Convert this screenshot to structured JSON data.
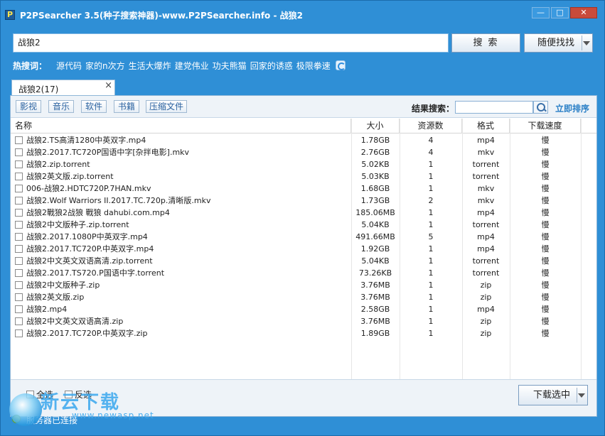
{
  "window": {
    "title": "P2PSearcher 3.5(种子搜索神器)-www.P2PSearcher.info - 战狼2",
    "logo_letter": "P",
    "minimize": "—",
    "maximize": "□",
    "close": "✕"
  },
  "search": {
    "query": "战狼2",
    "search_button": "搜索",
    "random_button": "随便找找"
  },
  "hot": {
    "label": "热搜词：",
    "items": [
      "源代码",
      "家的n次方",
      "生活大爆炸",
      "建党伟业",
      "功夫熊猫",
      "回家的诱惑",
      "极限拳速"
    ]
  },
  "tab": {
    "label": "战狼2(17)",
    "close": "×"
  },
  "toolbar": {
    "filters": [
      "影视",
      "音乐",
      "软件",
      "书籍",
      "压缩文件"
    ],
    "result_search_label": "结果搜索：",
    "sort_link": "立即排序"
  },
  "table": {
    "headers": [
      "名称",
      "大小",
      "资源数",
      "格式",
      "下载速度"
    ],
    "rows": [
      {
        "name": "战狼2.TS高清1280中英双字.mp4",
        "size": "1.78GB",
        "sources": "4",
        "format": "mp4",
        "speed": "慢"
      },
      {
        "name": "战狼2.2017.TC720P国语中字[杂拌电影].mkv",
        "size": "2.76GB",
        "sources": "4",
        "format": "mkv",
        "speed": "慢"
      },
      {
        "name": "战狼2.zip.torrent",
        "size": "5.02KB",
        "sources": "1",
        "format": "torrent",
        "speed": "慢"
      },
      {
        "name": "战狼2英文版.zip.torrent",
        "size": "5.03KB",
        "sources": "1",
        "format": "torrent",
        "speed": "慢"
      },
      {
        "name": "006-战狼2.HDTC720P.7HAN.mkv",
        "size": "1.68GB",
        "sources": "1",
        "format": "mkv",
        "speed": "慢"
      },
      {
        "name": "战狼2.Wolf Warriors II.2017.TC.720p.清晰版.mkv",
        "size": "1.73GB",
        "sources": "2",
        "format": "mkv",
        "speed": "慢"
      },
      {
        "name": "战狼2戰狼2战狼 戰狼 dahubi.com.mp4",
        "size": "185.06MB",
        "sources": "1",
        "format": "mp4",
        "speed": "慢"
      },
      {
        "name": "战狼2中文版种子.zip.torrent",
        "size": "5.04KB",
        "sources": "1",
        "format": "torrent",
        "speed": "慢"
      },
      {
        "name": "战狼2.2017.1080P中英双字.mp4",
        "size": "491.66MB",
        "sources": "5",
        "format": "mp4",
        "speed": "慢"
      },
      {
        "name": "战狼2.2017.TC720P.中英双字.mp4",
        "size": "1.92GB",
        "sources": "1",
        "format": "mp4",
        "speed": "慢"
      },
      {
        "name": "战狼2中文英文双语高清.zip.torrent",
        "size": "5.04KB",
        "sources": "1",
        "format": "torrent",
        "speed": "慢"
      },
      {
        "name": "战狼2.2017.TS720.P国语中字.torrent",
        "size": "73.26KB",
        "sources": "1",
        "format": "torrent",
        "speed": "慢"
      },
      {
        "name": "战狼2中文版种子.zip",
        "size": "3.76MB",
        "sources": "1",
        "format": "zip",
        "speed": "慢"
      },
      {
        "name": "战狼2英文版.zip",
        "size": "3.76MB",
        "sources": "1",
        "format": "zip",
        "speed": "慢"
      },
      {
        "name": "战狼2.mp4",
        "size": "2.58GB",
        "sources": "1",
        "format": "mp4",
        "speed": "慢"
      },
      {
        "name": "战狼2中文英文双语高清.zip",
        "size": "3.76MB",
        "sources": "1",
        "format": "zip",
        "speed": "慢"
      },
      {
        "name": "战狼2.2017.TC720P.中英双字.zip",
        "size": "1.89GB",
        "sources": "1",
        "format": "zip",
        "speed": "慢"
      }
    ]
  },
  "bottom": {
    "select_all": "全选",
    "invert": "反选",
    "download_button": "下载选中"
  },
  "status": {
    "text": "服务器已连接"
  },
  "watermark": {
    "text": "新云下载",
    "url": "www.newasp.net"
  }
}
